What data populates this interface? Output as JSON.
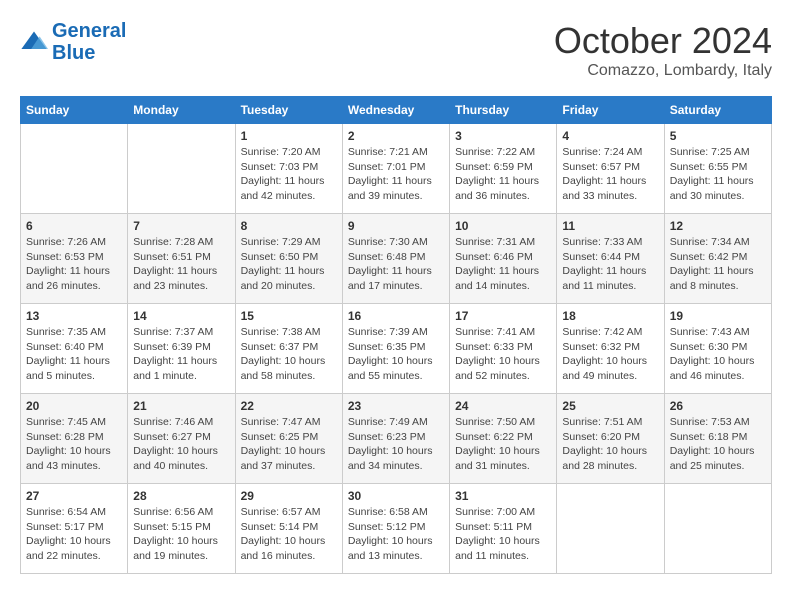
{
  "header": {
    "logo_line1": "General",
    "logo_line2": "Blue",
    "month": "October 2024",
    "location": "Comazzo, Lombardy, Italy"
  },
  "days_of_week": [
    "Sunday",
    "Monday",
    "Tuesday",
    "Wednesday",
    "Thursday",
    "Friday",
    "Saturday"
  ],
  "weeks": [
    [
      {
        "day": "",
        "info": ""
      },
      {
        "day": "",
        "info": ""
      },
      {
        "day": "1",
        "info": "Sunrise: 7:20 AM\nSunset: 7:03 PM\nDaylight: 11 hours and 42 minutes."
      },
      {
        "day": "2",
        "info": "Sunrise: 7:21 AM\nSunset: 7:01 PM\nDaylight: 11 hours and 39 minutes."
      },
      {
        "day": "3",
        "info": "Sunrise: 7:22 AM\nSunset: 6:59 PM\nDaylight: 11 hours and 36 minutes."
      },
      {
        "day": "4",
        "info": "Sunrise: 7:24 AM\nSunset: 6:57 PM\nDaylight: 11 hours and 33 minutes."
      },
      {
        "day": "5",
        "info": "Sunrise: 7:25 AM\nSunset: 6:55 PM\nDaylight: 11 hours and 30 minutes."
      }
    ],
    [
      {
        "day": "6",
        "info": "Sunrise: 7:26 AM\nSunset: 6:53 PM\nDaylight: 11 hours and 26 minutes."
      },
      {
        "day": "7",
        "info": "Sunrise: 7:28 AM\nSunset: 6:51 PM\nDaylight: 11 hours and 23 minutes."
      },
      {
        "day": "8",
        "info": "Sunrise: 7:29 AM\nSunset: 6:50 PM\nDaylight: 11 hours and 20 minutes."
      },
      {
        "day": "9",
        "info": "Sunrise: 7:30 AM\nSunset: 6:48 PM\nDaylight: 11 hours and 17 minutes."
      },
      {
        "day": "10",
        "info": "Sunrise: 7:31 AM\nSunset: 6:46 PM\nDaylight: 11 hours and 14 minutes."
      },
      {
        "day": "11",
        "info": "Sunrise: 7:33 AM\nSunset: 6:44 PM\nDaylight: 11 hours and 11 minutes."
      },
      {
        "day": "12",
        "info": "Sunrise: 7:34 AM\nSunset: 6:42 PM\nDaylight: 11 hours and 8 minutes."
      }
    ],
    [
      {
        "day": "13",
        "info": "Sunrise: 7:35 AM\nSunset: 6:40 PM\nDaylight: 11 hours and 5 minutes."
      },
      {
        "day": "14",
        "info": "Sunrise: 7:37 AM\nSunset: 6:39 PM\nDaylight: 11 hours and 1 minute."
      },
      {
        "day": "15",
        "info": "Sunrise: 7:38 AM\nSunset: 6:37 PM\nDaylight: 10 hours and 58 minutes."
      },
      {
        "day": "16",
        "info": "Sunrise: 7:39 AM\nSunset: 6:35 PM\nDaylight: 10 hours and 55 minutes."
      },
      {
        "day": "17",
        "info": "Sunrise: 7:41 AM\nSunset: 6:33 PM\nDaylight: 10 hours and 52 minutes."
      },
      {
        "day": "18",
        "info": "Sunrise: 7:42 AM\nSunset: 6:32 PM\nDaylight: 10 hours and 49 minutes."
      },
      {
        "day": "19",
        "info": "Sunrise: 7:43 AM\nSunset: 6:30 PM\nDaylight: 10 hours and 46 minutes."
      }
    ],
    [
      {
        "day": "20",
        "info": "Sunrise: 7:45 AM\nSunset: 6:28 PM\nDaylight: 10 hours and 43 minutes."
      },
      {
        "day": "21",
        "info": "Sunrise: 7:46 AM\nSunset: 6:27 PM\nDaylight: 10 hours and 40 minutes."
      },
      {
        "day": "22",
        "info": "Sunrise: 7:47 AM\nSunset: 6:25 PM\nDaylight: 10 hours and 37 minutes."
      },
      {
        "day": "23",
        "info": "Sunrise: 7:49 AM\nSunset: 6:23 PM\nDaylight: 10 hours and 34 minutes."
      },
      {
        "day": "24",
        "info": "Sunrise: 7:50 AM\nSunset: 6:22 PM\nDaylight: 10 hours and 31 minutes."
      },
      {
        "day": "25",
        "info": "Sunrise: 7:51 AM\nSunset: 6:20 PM\nDaylight: 10 hours and 28 minutes."
      },
      {
        "day": "26",
        "info": "Sunrise: 7:53 AM\nSunset: 6:18 PM\nDaylight: 10 hours and 25 minutes."
      }
    ],
    [
      {
        "day": "27",
        "info": "Sunrise: 6:54 AM\nSunset: 5:17 PM\nDaylight: 10 hours and 22 minutes."
      },
      {
        "day": "28",
        "info": "Sunrise: 6:56 AM\nSunset: 5:15 PM\nDaylight: 10 hours and 19 minutes."
      },
      {
        "day": "29",
        "info": "Sunrise: 6:57 AM\nSunset: 5:14 PM\nDaylight: 10 hours and 16 minutes."
      },
      {
        "day": "30",
        "info": "Sunrise: 6:58 AM\nSunset: 5:12 PM\nDaylight: 10 hours and 13 minutes."
      },
      {
        "day": "31",
        "info": "Sunrise: 7:00 AM\nSunset: 5:11 PM\nDaylight: 10 hours and 11 minutes."
      },
      {
        "day": "",
        "info": ""
      },
      {
        "day": "",
        "info": ""
      }
    ]
  ]
}
